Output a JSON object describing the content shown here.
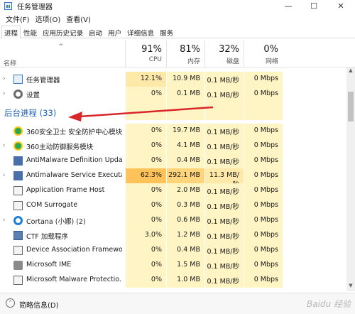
{
  "window": {
    "title": "任务管理器",
    "controls": {
      "minimize": "—",
      "maximize": "☐",
      "close": "✕"
    }
  },
  "menu": [
    "文件(F)",
    "选项(O)",
    "查看(V)"
  ],
  "tabs": [
    {
      "label": "进程",
      "active": true
    },
    {
      "label": "性能",
      "active": false
    },
    {
      "label": "应用历史记录",
      "active": false
    },
    {
      "label": "启动",
      "active": false
    },
    {
      "label": "用户",
      "active": false
    },
    {
      "label": "详细信息",
      "active": false
    },
    {
      "label": "服务",
      "active": false
    }
  ],
  "header": {
    "sort_indicator": "^",
    "name_label": "名称",
    "columns": [
      {
        "key": "cpu",
        "pct": "91%",
        "label": "CPU"
      },
      {
        "key": "mem",
        "pct": "81%",
        "label": "内存"
      },
      {
        "key": "disk",
        "pct": "32%",
        "label": "磁盘"
      },
      {
        "key": "net",
        "pct": "0%",
        "label": "网络"
      }
    ]
  },
  "apps": [
    {
      "expand": "›",
      "icon": "task-manager-icon",
      "name": "任务管理器",
      "cpu": "12.1%",
      "mem": "10.9 MB",
      "disk": "0.1 MB/秒",
      "net": "0 Mbps"
    },
    {
      "expand": "›",
      "icon": "settings-gear-icon",
      "name": "设置",
      "cpu": "0%",
      "mem": "0.1 MB",
      "disk": "0.1 MB/秒",
      "net": "0 Mbps"
    }
  ],
  "group": {
    "title": "后台进程 (33)"
  },
  "background": [
    {
      "expand": "",
      "icon": "360-shield-icon",
      "name": "360安全卫士 安全防护中心模块",
      "cpu": "0%",
      "mem": "19.7 MB",
      "disk": "0.1 MB/秒",
      "net": "0 Mbps"
    },
    {
      "expand": "›",
      "icon": "360-shield-icon",
      "name": "360主动防御服务模块",
      "cpu": "0%",
      "mem": "4.1 MB",
      "disk": "0.1 MB/秒",
      "net": "0 Mbps"
    },
    {
      "expand": "",
      "icon": "windows-app-icon",
      "name": "AntiMalware Definition Upda...",
      "cpu": "0%",
      "mem": "0.4 MB",
      "disk": "0.1 MB/秒",
      "net": "0 Mbps"
    },
    {
      "expand": "›",
      "icon": "windows-app-icon",
      "name": "Antimalware Service Executa...",
      "cpu": "62.3%",
      "mem": "292.1 MB",
      "disk": "11.3 MB/秒",
      "net": "0 Mbps"
    },
    {
      "expand": "",
      "icon": "app-window-icon",
      "name": "Application Frame Host",
      "cpu": "0%",
      "mem": "2.0 MB",
      "disk": "0.1 MB/秒",
      "net": "0 Mbps"
    },
    {
      "expand": "",
      "icon": "app-window-icon",
      "name": "COM Surrogate",
      "cpu": "0%",
      "mem": "0.3 MB",
      "disk": "0.1 MB/秒",
      "net": "0 Mbps"
    },
    {
      "expand": "›",
      "icon": "cortana-icon",
      "name": "Cortana (小娜) (2)",
      "cpu": "0%",
      "mem": "0.6 MB",
      "disk": "0.1 MB/秒",
      "net": "0 Mbps"
    },
    {
      "expand": "",
      "icon": "ctf-loader-icon",
      "name": "CTF 加载程序",
      "cpu": "3.0%",
      "mem": "1.2 MB",
      "disk": "0.1 MB/秒",
      "net": "0 Mbps"
    },
    {
      "expand": "",
      "icon": "app-window-icon",
      "name": "Device Association Framewo...",
      "cpu": "0%",
      "mem": "0.4 MB",
      "disk": "0.1 MB/秒",
      "net": "0 Mbps"
    },
    {
      "expand": "",
      "icon": "ime-icon",
      "name": "Microsoft IME",
      "cpu": "0%",
      "mem": "1.5 MB",
      "disk": "0.1 MB/秒",
      "net": "0 Mbps"
    },
    {
      "expand": "",
      "icon": "app-window-icon",
      "name": "Microsoft Malware Protectio...",
      "cpu": "0%",
      "mem": "1.0 MB",
      "disk": "0.1 MB/秒",
      "net": "0 Mbps"
    }
  ],
  "footer": {
    "fewer_details": "简略信息(D)",
    "watermark": "Baidu 经验"
  },
  "colors": {
    "heat_light": "#fff4c4",
    "heat_mid": "#ffe9a8",
    "heat_high": "#ffc35a",
    "heat_high_mem": "#ffd47a",
    "group_blue": "#1e5fb4",
    "annotation_red": "#d8262b"
  }
}
